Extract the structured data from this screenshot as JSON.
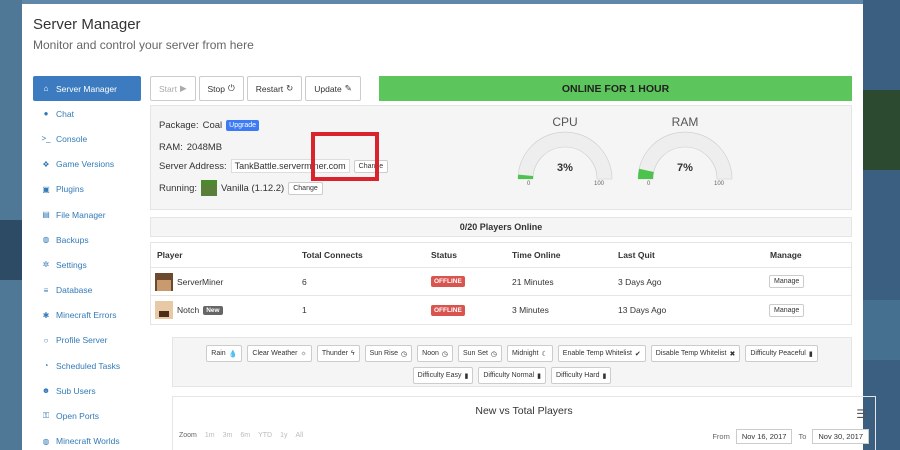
{
  "header": {
    "title": "Server Manager",
    "subtitle": "Monitor and control your server from here"
  },
  "sidebar": {
    "items": [
      {
        "label": "Server Manager",
        "icon": "home-icon",
        "glyph": "⌂",
        "active": true
      },
      {
        "label": "Chat",
        "icon": "chat-icon",
        "glyph": "●"
      },
      {
        "label": "Console",
        "icon": "terminal-icon",
        "glyph": ">_"
      },
      {
        "label": "Game Versions",
        "icon": "cubes-icon",
        "glyph": "❖"
      },
      {
        "label": "Plugins",
        "icon": "plugin-icon",
        "glyph": "▣"
      },
      {
        "label": "File Manager",
        "icon": "file-icon",
        "glyph": "▤"
      },
      {
        "label": "Backups",
        "icon": "globe-icon",
        "glyph": "◍"
      },
      {
        "label": "Settings",
        "icon": "gear-icon",
        "glyph": "✲"
      },
      {
        "label": "Database",
        "icon": "database-icon",
        "glyph": "≡"
      },
      {
        "label": "Minecraft Errors",
        "icon": "bug-icon",
        "glyph": "✱"
      },
      {
        "label": "Profile Server",
        "icon": "search-icon",
        "glyph": "○"
      },
      {
        "label": "Scheduled Tasks",
        "icon": "clock-icon",
        "glyph": "◔"
      },
      {
        "label": "Sub Users",
        "icon": "users-icon",
        "glyph": "☻"
      },
      {
        "label": "Open Ports",
        "icon": "unlock-icon",
        "glyph": "⚿"
      },
      {
        "label": "Minecraft Worlds",
        "icon": "globe-icon",
        "glyph": "◍"
      }
    ]
  },
  "toolbar": {
    "start": "Start",
    "stop": "Stop",
    "restart": "Restart",
    "update": "Update",
    "status": "ONLINE FOR 1 HOUR"
  },
  "info": {
    "package_label": "Package:",
    "package_value": "Coal",
    "upgrade": "Upgrade",
    "ram_label": "RAM:",
    "ram_value": "2048MB",
    "address_label": "Server Address:",
    "address_value": "TankBattle.serverminer.com",
    "change": "Change",
    "running_label": "Running:",
    "running_value": "Vanilla (1.12.2)"
  },
  "gauges": {
    "cpu": {
      "title": "CPU",
      "value": 3,
      "display": "3%",
      "min": "0",
      "max": "100"
    },
    "ram": {
      "title": "RAM",
      "value": 7,
      "display": "7%",
      "min": "0",
      "max": "100"
    },
    "fill_color": "#4cc34c",
    "track_color": "#eeeeee"
  },
  "players": {
    "heading": "0/20 Players Online",
    "columns": [
      "Player",
      "Total Connects",
      "Status",
      "Time Online",
      "Last Quit",
      "Manage"
    ],
    "rows": [
      {
        "name": "ServerMiner",
        "badge": "",
        "connects": "6",
        "status": "OFFLINE",
        "time": "21 Minutes",
        "last_quit": "3 Days Ago",
        "manage": "Manage"
      },
      {
        "name": "Notch",
        "badge": "New",
        "connects": "1",
        "status": "OFFLINE",
        "time": "3 Minutes",
        "last_quit": "13 Days Ago",
        "manage": "Manage"
      }
    ]
  },
  "weather": {
    "row1": [
      {
        "label": "Rain",
        "icon": "rain-icon",
        "glyph": "💧"
      },
      {
        "label": "Clear Weather",
        "icon": "sun-icon",
        "glyph": "☼"
      },
      {
        "label": "Thunder",
        "icon": "bolt-icon",
        "glyph": "ϟ"
      },
      {
        "label": "Sun Rise",
        "icon": "clock-icon",
        "glyph": "◷"
      },
      {
        "label": "Noon",
        "icon": "clock-icon",
        "glyph": "◷"
      },
      {
        "label": "Sun Set",
        "icon": "clock-icon",
        "glyph": "◷"
      },
      {
        "label": "Midnight",
        "icon": "moon-icon",
        "glyph": "☾"
      },
      {
        "label": "Enable Temp Whitelist",
        "icon": "check-icon",
        "glyph": "✔"
      },
      {
        "label": "Disable Temp Whitelist",
        "icon": "close-icon",
        "glyph": "✖"
      },
      {
        "label": "Difficulty Peaceful",
        "icon": "book-icon",
        "glyph": "▮"
      }
    ],
    "row2": [
      {
        "label": "Difficulty Easy",
        "icon": "book-icon",
        "glyph": "▮"
      },
      {
        "label": "Difficulty Normal",
        "icon": "book-icon",
        "glyph": "▮"
      },
      {
        "label": "Difficulty Hard",
        "icon": "book-icon",
        "glyph": "▮"
      }
    ]
  },
  "chart": {
    "title": "New vs Total Players",
    "zoom_label": "Zoom",
    "zoom_options": [
      "1m",
      "3m",
      "6m",
      "YTD",
      "1y",
      "All"
    ],
    "from_label": "From",
    "from_value": "Nov 16, 2017",
    "to_label": "To",
    "to_value": "Nov 30, 2017"
  }
}
